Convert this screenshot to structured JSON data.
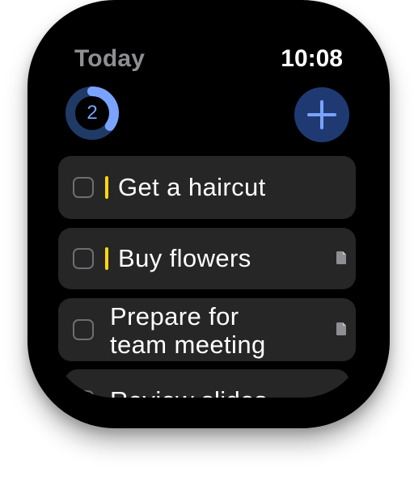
{
  "header": {
    "title": "Today",
    "time": "10:08"
  },
  "progress": {
    "remaining_count": "2",
    "fraction_complete": 0.35,
    "ring_color": "#7aa2ff",
    "track_color": "#203a66"
  },
  "add_button": {
    "icon": "plus-icon",
    "background_color": "#1f3a73",
    "icon_color": "#7aa2ff"
  },
  "tasks": [
    {
      "title_line1": "Get a haircut",
      "title_line2": "",
      "flagged": true,
      "has_note": false
    },
    {
      "title_line1": "Buy flowers",
      "title_line2": "",
      "flagged": true,
      "has_note": true
    },
    {
      "title_line1": "Prepare for",
      "title_line2": "team meeting",
      "flagged": false,
      "has_note": true
    },
    {
      "title_line1": "Review slides",
      "title_line2": "",
      "flagged": false,
      "has_note": false
    }
  ],
  "colors": {
    "flag": "#ffd60a",
    "card_background": "#262626",
    "checkbox_border": "#6e6e73"
  }
}
